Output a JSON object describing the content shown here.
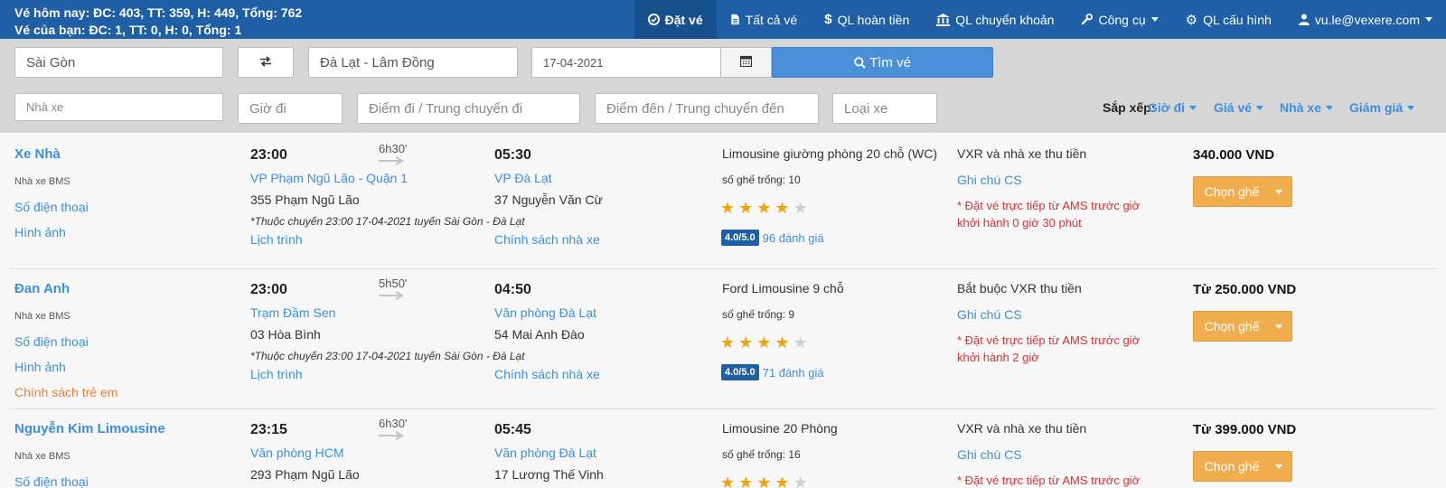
{
  "header": {
    "stats_today": "Vé hôm nay: ĐC: 403, TT: 359, H: 449, Tổng: 762",
    "stats_yours": "Vé của bạn: ĐC: 1, TT: 0, H: 0, Tổng: 1",
    "nav": [
      {
        "label": "Đặt vé",
        "icon": "check-circle-icon",
        "active": true
      },
      {
        "label": "Tất cả vé",
        "icon": "file-icon"
      },
      {
        "label": "QL hoàn tiền",
        "icon": "dollar-icon"
      },
      {
        "label": "QL chuyển khoản",
        "icon": "bank-icon"
      },
      {
        "label": "Công cụ",
        "icon": "wrench-icon",
        "dropdown": true
      },
      {
        "label": "QL cấu hình",
        "icon": "gear-icon"
      },
      {
        "label": "vu.le@vexere.com",
        "icon": "user-icon",
        "dropdown": true
      }
    ]
  },
  "search": {
    "from": "Sài Gòn",
    "to": "Đà Lạt - Lâm Đồng",
    "date": "17-04-2021",
    "search_label": "Tìm vé"
  },
  "filters": {
    "operator": "Nhà xe",
    "departure_time": "Giờ đi",
    "pickup": "Điểm đi / Trung chuyển đi",
    "dropoff": "Điểm đến / Trung chuyển đến",
    "vehicle_type": "Loại xe"
  },
  "sort": {
    "label": "Sắp xếp:",
    "options": [
      "Giờ đi",
      "Giá vé",
      "Nhà xe",
      "Giảm giá"
    ]
  },
  "trips": [
    {
      "operator": "Xe Nhà",
      "operator_sub": "Nhà xe BMS",
      "phone_link": "Số điện thoại",
      "images_link": "Hình ảnh",
      "extra_link": "",
      "depart_time": "23:00",
      "duration": "6h30'",
      "arrive_time": "05:30",
      "from_station": "VP Phạm Ngũ Lão - Quận 1",
      "from_address": "355 Phạm Ngũ Lão",
      "to_station": "VP Đà Lạt",
      "to_address": "37 Nguyễn Văn Cừ",
      "route_note": "*Thuộc chuyến 23:00 17-04-2021 tuyến Sài Gòn - Đà Lạt",
      "schedule_link": "Lịch trình",
      "policy_link": "Chính sách nhà xe",
      "vehicle": "Limousine giường phòng 20 chỗ (WC)",
      "seats": "số ghế trống: 10",
      "stars": 4,
      "rating": "4.0/5.0",
      "reviews": "96 đánh giá",
      "payment": "VXR và nhà xe thu tiền",
      "cs_link": "Ghi chú CS",
      "warning": "* Đặt vé trực tiếp từ AMS trước giờ khởi hành 0 giờ 30 phút",
      "price": "340.000 VND",
      "book_label": "Chọn ghế"
    },
    {
      "operator": "Đan Anh",
      "operator_sub": "Nhà xe BMS",
      "phone_link": "Số điện thoại",
      "images_link": "Hình ảnh",
      "extra_link": "Chính sách trẻ em",
      "depart_time": "23:00",
      "duration": "5h50'",
      "arrive_time": "04:50",
      "from_station": "Trạm Đầm Sen",
      "from_address": "03 Hòa Bình",
      "to_station": "Văn phòng Đà Lạt",
      "to_address": "54 Mai Anh Đào",
      "route_note": "*Thuộc chuyến 23:00 17-04-2021 tuyến Sài Gòn - Đà Lạt",
      "schedule_link": "Lịch trình",
      "policy_link": "Chính sách nhà xe",
      "vehicle": "Ford Limousine 9 chỗ",
      "seats": "số ghế trống: 9",
      "stars": 4,
      "rating": "4.0/5.0",
      "reviews": "71 đánh giá",
      "payment": "Bắt buộc VXR thu tiền",
      "cs_link": "Ghi chú CS",
      "warning": "* Đặt vé trực tiếp từ AMS trước giờ khởi hành 2 giờ",
      "price": "Từ 250.000 VND",
      "book_label": "Chọn ghế"
    },
    {
      "operator": "Nguyễn Kim Limousine",
      "operator_sub": "Nhà xe BMS",
      "phone_link": "Số điện thoại",
      "images_link": "",
      "extra_link": "",
      "depart_time": "23:15",
      "duration": "6h30'",
      "arrive_time": "05:45",
      "from_station": "Văn phòng HCM",
      "from_address": "293 Phạm Ngũ Lão",
      "to_station": "Văn phòng Đà Lạt",
      "to_address": "17 Lương Thế Vinh",
      "route_note": "",
      "schedule_link": "",
      "policy_link": "",
      "vehicle": "Limousine 20 Phòng",
      "seats": "số ghế trống: 16",
      "stars": 4,
      "rating": "",
      "reviews": "",
      "payment": "VXR và nhà xe thu tiền",
      "cs_link": "Ghi chú CS",
      "warning": "* Đặt vé trực tiếp từ AMS trước giờ",
      "price": "Từ 399.000 VND",
      "book_label": "Chọn ghế"
    }
  ]
}
